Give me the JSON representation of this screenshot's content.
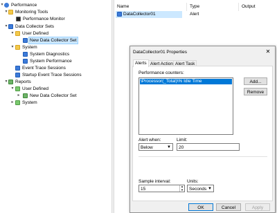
{
  "tree": {
    "items": [
      {
        "label": "Performance",
        "icon": "performance-icon"
      },
      {
        "label": "Monitoring Tools",
        "icon": "folder-icon"
      },
      {
        "label": "Performance Monitor",
        "icon": "monitor-icon"
      },
      {
        "label": "Data Collector Sets",
        "icon": "data-collector-icon"
      },
      {
        "label": "User Defined",
        "icon": "folder-icon"
      },
      {
        "label": "New Data Collector Set",
        "icon": "data-collector-icon"
      },
      {
        "label": "System",
        "icon": "folder-icon"
      },
      {
        "label": "System Diagnostics",
        "icon": "data-collector-icon"
      },
      {
        "label": "System Performance",
        "icon": "data-collector-icon"
      },
      {
        "label": "Event Trace Sessions",
        "icon": "data-collector-icon"
      },
      {
        "label": "Startup Event Trace Sessions",
        "icon": "data-collector-icon"
      },
      {
        "label": "Reports",
        "icon": "report-icon"
      },
      {
        "label": "User Defined",
        "icon": "folder-icon"
      },
      {
        "label": "New Data Collector Set",
        "icon": "report-icon"
      },
      {
        "label": "System",
        "icon": "folder-icon"
      }
    ]
  },
  "list": {
    "columns": [
      "Name",
      "Type",
      "Output"
    ],
    "rows": [
      {
        "name": "DataCollector01",
        "type": "Alert",
        "output": ""
      }
    ]
  },
  "dialog": {
    "title": "DataCollector01 Properties",
    "close": "✕",
    "tabs": [
      "Alerts",
      "Alert Action",
      "Alert Task"
    ],
    "counters_label": "Performance counters:",
    "counter_item": "\\Processor(_Total)\\% Idle Time",
    "add_button": "Add...",
    "remove_button": "Remove",
    "alert_when_label": "Alert when:",
    "alert_when_value": "Below",
    "limit_label": "Limit:",
    "limit_value": "20",
    "sample_interval_label": "Sample interval:",
    "sample_interval_value": "15",
    "units_label": "Units:",
    "units_value": "Seconds",
    "ok_button": "OK",
    "cancel_button": "Cancel",
    "apply_button": "Apply"
  }
}
